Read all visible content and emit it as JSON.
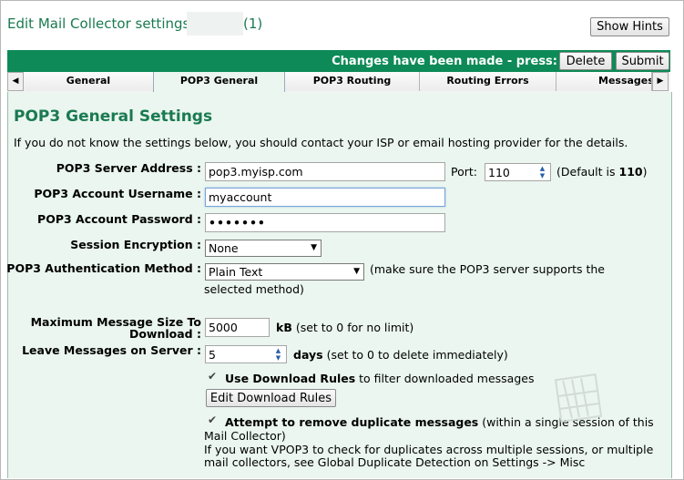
{
  "header": {
    "title": "Edit Mail Collector settings -",
    "count": "(1)",
    "show_hints": "Show Hints"
  },
  "bar": {
    "changes_text": "Changes have been made - press:",
    "delete_label": "Delete",
    "submit_label": "Submit"
  },
  "tabs": [
    "General",
    "POP3 General",
    "POP3 Routing",
    "Routing Errors",
    "Messages"
  ],
  "icons": {
    "left": "◀",
    "right": "▶",
    "check": "✔",
    "spin_up": "▲",
    "spin_down": "▼",
    "dropdown": "▼"
  },
  "section": {
    "title": "POP3 General Settings",
    "intro": "If you do not know the settings below, you should contact your ISP or email hosting provider for the details."
  },
  "server": {
    "label": "POP3 Server Address :",
    "value": "pop3.myisp.com",
    "port_label": "Port:",
    "port_value": "110",
    "port_note_prefix": "(Default is",
    "port_default": "110",
    "port_note_suffix": ")"
  },
  "username": {
    "label": "POP3 Account Username :",
    "value": "myaccount"
  },
  "password": {
    "label": "POP3 Account Password :",
    "value": "•••••••"
  },
  "encryption": {
    "label": "Session Encryption :",
    "value": "None"
  },
  "auth": {
    "label": "POP3 Authentication Method :",
    "value": "Plain Text",
    "note1": "(make sure the POP3 server supports the",
    "note2": "selected method)"
  },
  "maxsize": {
    "label1": "Maximum Message Size To",
    "label2": "Download :",
    "value": "5000",
    "unit": "kB",
    "note": "(set to 0 for no limit)"
  },
  "leave": {
    "label": "Leave Messages on Server :",
    "value": "5",
    "unit": "days",
    "note": "(set to 0 to delete immediately)"
  },
  "rules": {
    "bold": "Use Download Rules",
    "text": "to filter downloaded messages",
    "button": "Edit Download Rules"
  },
  "duplicates": {
    "bold": "Attempt to remove duplicate messages",
    "text": "(within a single session of this",
    "line2": "Mail Collector)",
    "line3": "If you want VPOP3 to check for duplicates across multiple sessions, or multiple",
    "line4": "mail collectors, see Global Duplicate Detection on Settings -> Misc"
  }
}
